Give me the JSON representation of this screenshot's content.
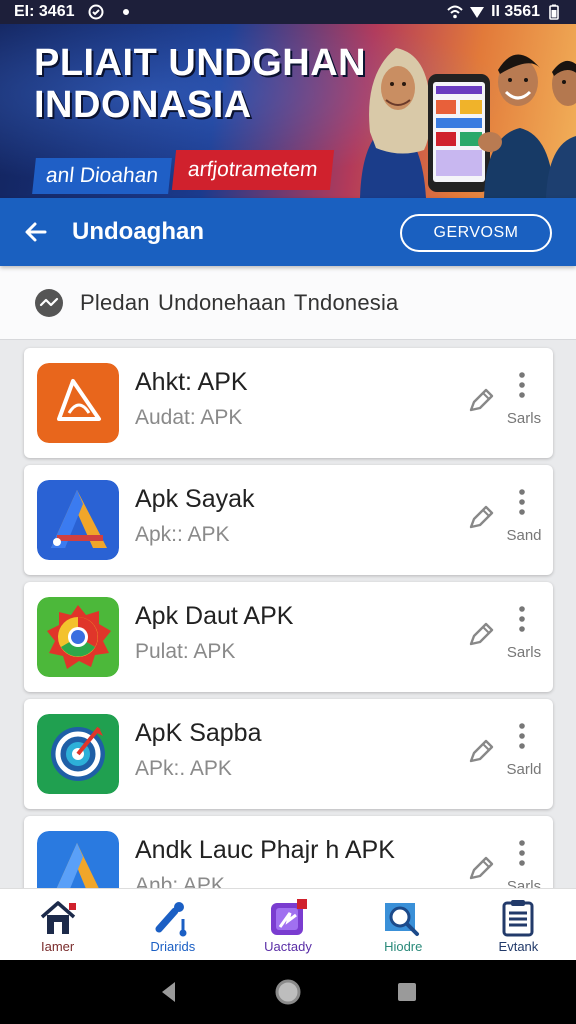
{
  "status_bar": {
    "time": "EI: 3461",
    "right_text": "II 3561"
  },
  "banner": {
    "title": "PLIAIT UNDGHAN INDONASIA",
    "tag_primary": "anl Dioahan",
    "tag_secondary": "arfjotrametem"
  },
  "app_bar": {
    "title": "Undoaghan",
    "action_label": "GERVOSM"
  },
  "subheader": {
    "text": "Pledan Undonehaan  Tndonesia"
  },
  "apps": [
    {
      "name": "Ahkt: APK",
      "subtitle": "Audat: APK",
      "status": "Sarls",
      "icon": "orange-triangle-app-icon"
    },
    {
      "name": "Apk Sayak",
      "subtitle": "Apk:: APK",
      "status": "Sand",
      "icon": "blue-a-app-icon"
    },
    {
      "name": "Apk Daut APK",
      "subtitle": "Pulat: APK",
      "status": "Sarls",
      "icon": "chrome-style-app-icon"
    },
    {
      "name": "ApK Sapba",
      "subtitle": "APk:. APK",
      "status": "Sarld",
      "icon": "green-ring-app-icon"
    },
    {
      "name": "Andk Lauc Phajr h APK",
      "subtitle": "Anb: APK",
      "status": "Sarls",
      "icon": "blue-orange-a-app-icon"
    }
  ],
  "bottom_nav": [
    {
      "label": "Iamer",
      "icon": "home-icon",
      "color": "#7a2c2c"
    },
    {
      "label": "Driarids",
      "icon": "tools-icon",
      "color": "#1b5fc4"
    },
    {
      "label": "Uactady",
      "icon": "media-icon",
      "color": "#5a2ea6"
    },
    {
      "label": "Hiodre",
      "icon": "search-icon",
      "color": "#2a8a7a"
    },
    {
      "label": "Evtank",
      "icon": "clipboard-icon",
      "color": "#223a6a"
    }
  ],
  "colors": {
    "app_bar": "#1a60c0",
    "accent_red": "#d0212d",
    "background": "#e9eaec"
  }
}
